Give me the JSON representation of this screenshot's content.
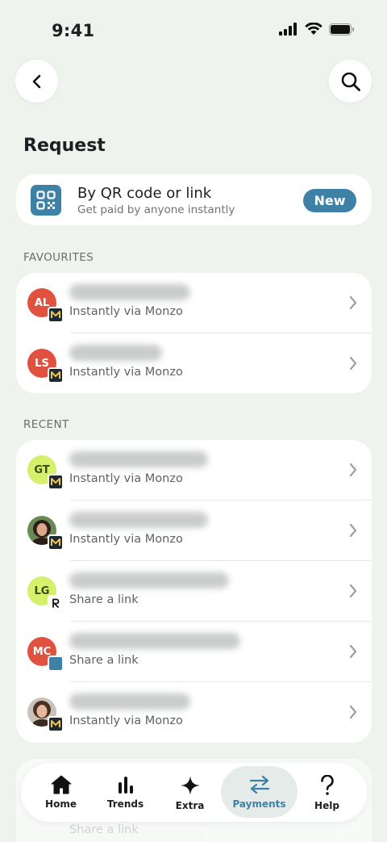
{
  "status": {
    "time": "9:41"
  },
  "page": {
    "title": "Request"
  },
  "qr": {
    "title": "By QR code or link",
    "subtitle": "Get paid by anyone instantly",
    "badge": "New"
  },
  "favourites": {
    "label": "FAVOURITES",
    "items": [
      {
        "initials": "AL",
        "subtitle": "Instantly via Monzo"
      },
      {
        "initials": "LS",
        "subtitle": "Instantly via Monzo"
      }
    ]
  },
  "recent": {
    "label": "RECENT",
    "items": [
      {
        "initials": "GT",
        "subtitle": "Instantly via Monzo"
      },
      {
        "initials": "",
        "subtitle": "Instantly via Monzo"
      },
      {
        "initials": "LG",
        "subtitle": "Share a link"
      },
      {
        "initials": "MC",
        "subtitle": "Share a link"
      },
      {
        "initials": "",
        "subtitle": "Instantly via Monzo"
      }
    ]
  },
  "ghost": {
    "subtitle": "Share a link"
  },
  "tabs": [
    {
      "label": "Home"
    },
    {
      "label": "Trends"
    },
    {
      "label": "Extra"
    },
    {
      "label": "Payments"
    },
    {
      "label": "Help"
    }
  ],
  "colors": {
    "background": "#eef3ee",
    "accent": "#3d82a6",
    "avatar_red": "#e0523f",
    "avatar_lime": "#d5f06a"
  }
}
